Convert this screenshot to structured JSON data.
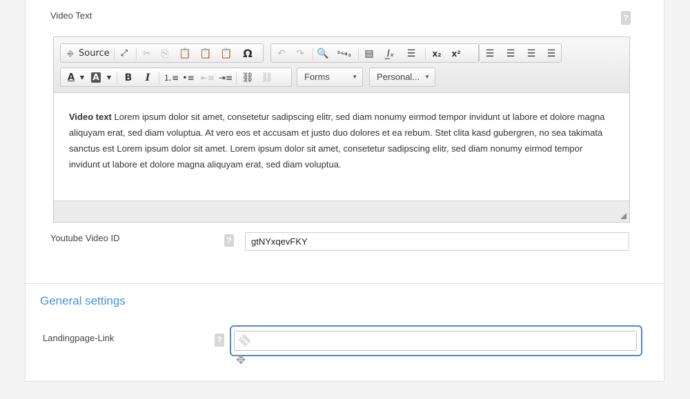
{
  "video_text": {
    "label": "Video Text",
    "help": "?"
  },
  "toolbar": {
    "row1": [
      "Source",
      "maximize",
      "cut",
      "copy",
      "paste",
      "paste-text",
      "paste-word",
      "Ω",
      "undo",
      "redo",
      "find",
      "replace",
      "show-blocks",
      "remove-format",
      "horizontal-rule",
      "subscript",
      "superscript",
      "align-left",
      "align-center",
      "align-right",
      "justify"
    ],
    "source_label": "Source",
    "omega": "Ω",
    "bold": "B",
    "italic": "I",
    "text_color": "A",
    "bg_color": "A",
    "forms_label": "Forms",
    "personal_label": "Personal..."
  },
  "editor_content": {
    "bold_lead": "Video text",
    "body": " Lorem ipsum dolor sit amet, consetetur sadipscing elitr, sed diam nonumy eirmod tempor invidunt ut labore et dolore magna aliquyam erat, sed diam voluptua. At vero eos et accusam et justo duo dolores et ea rebum. Stet clita kasd gubergren, no sea takimata sanctus est Lorem ipsum dolor sit amet. Lorem ipsum dolor sit amet, consetetur sadipscing elitr, sed diam nonumy eirmod tempor invidunt ut labore et dolore magna aliquyam erat, sed diam voluptua."
  },
  "youtube": {
    "label": "Youtube Video ID",
    "value": "gtNYxqevFKY",
    "help": "?"
  },
  "general_settings": {
    "title": "General settings"
  },
  "landingpage": {
    "label": "Landingpage-Link",
    "value": "",
    "help": "?"
  },
  "colors": {
    "accent": "#4a90d9",
    "focus": "#4a87d8"
  }
}
